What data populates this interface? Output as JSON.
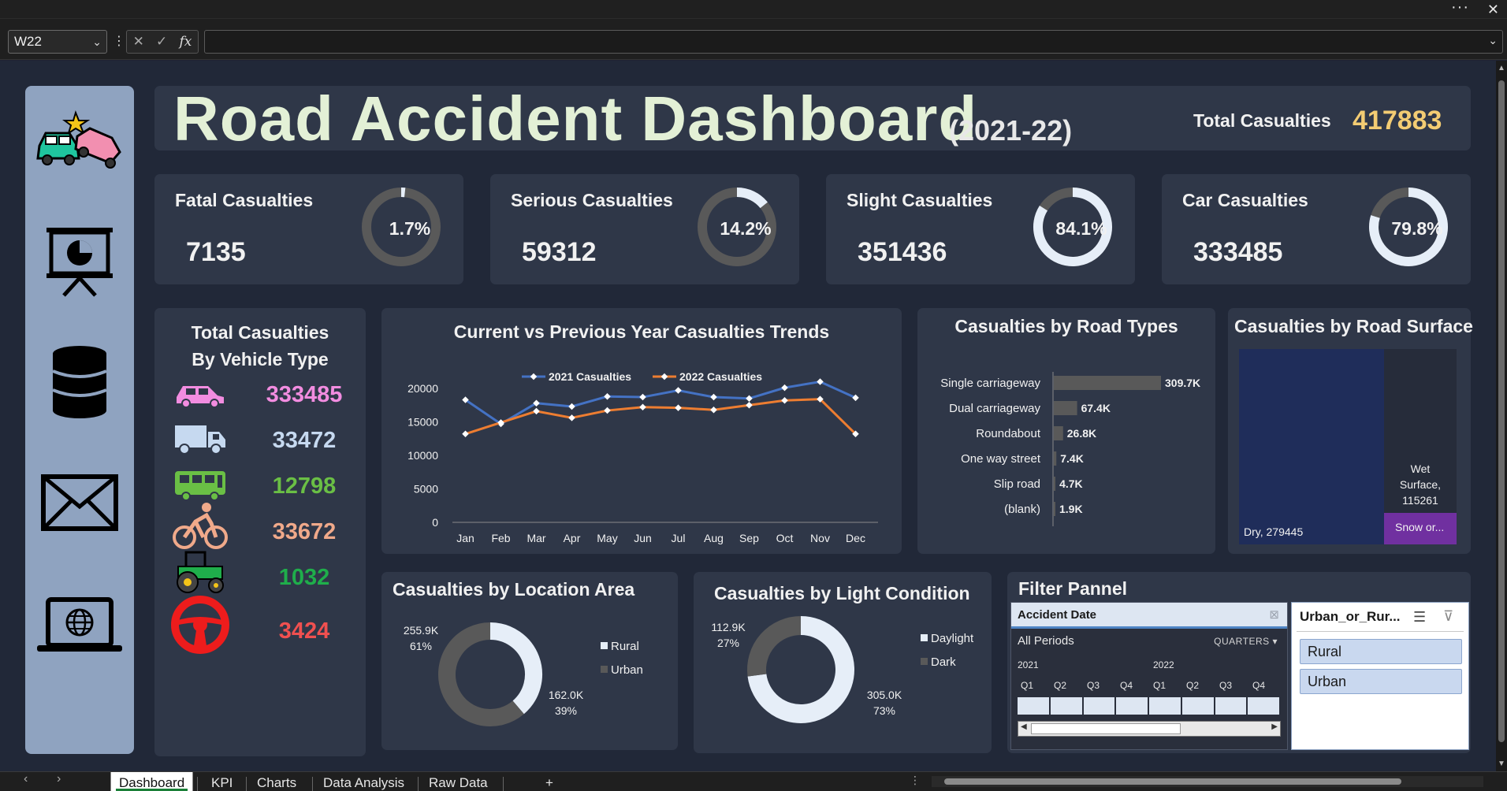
{
  "window": {
    "more_label": "···",
    "close_label": "✕"
  },
  "formula_bar": {
    "name_box": "W22",
    "fx_label": "fx",
    "formula": ""
  },
  "dashboard": {
    "title": "Road Accident Dashboard",
    "year": "(2021-22)",
    "total_label": "Total Casualties",
    "total_value": "417883",
    "kpis": [
      {
        "label": "Fatal Casualties",
        "value": "7135",
        "pct_label": "1.7%",
        "pct": 0.017
      },
      {
        "label": "Serious Casualties",
        "value": "59312",
        "pct_label": "14.2%",
        "pct": 0.142
      },
      {
        "label": "Slight Casualties",
        "value": "351436",
        "pct_label": "84.1%",
        "pct": 0.841
      },
      {
        "label": "Car Casualties",
        "value": "333485",
        "pct_label": "79.8%",
        "pct": 0.798
      }
    ],
    "vehicle": {
      "title_line1": "Total Casualties",
      "title_line2": "By Vehicle Type",
      "rows": [
        {
          "icon": "car-icon",
          "value": "333485",
          "color": "#f28ce0"
        },
        {
          "icon": "truck-icon",
          "value": "33472",
          "color": "#c6d9f0"
        },
        {
          "icon": "bus-icon",
          "value": "12798",
          "color": "#6abf45"
        },
        {
          "icon": "bicycle-icon",
          "value": "33672",
          "color": "#f0a98a"
        },
        {
          "icon": "tractor-icon",
          "value": "1032",
          "color": "#1fae4b"
        },
        {
          "icon": "steering-wheel-icon",
          "value": "3424",
          "color": "#f05050"
        }
      ]
    },
    "colors": {
      "accent_title": "#e3f0d6",
      "total_value": "#f3cc73",
      "series_2021": "#4472c4",
      "series_2022": "#ed7d31",
      "bar": "#595959"
    }
  },
  "chart_data": [
    {
      "type": "line",
      "title": "Current vs Previous Year Casualties Trends",
      "categories": [
        "Jan",
        "Feb",
        "Mar",
        "Apr",
        "May",
        "Jun",
        "Jul",
        "Aug",
        "Sep",
        "Oct",
        "Nov",
        "Dec"
      ],
      "series": [
        {
          "name": "2021 Casualties",
          "values": [
            18300,
            14700,
            17800,
            17300,
            18800,
            18700,
            19700,
            18700,
            18500,
            20100,
            21000,
            18600
          ]
        },
        {
          "name": "2022 Casualties",
          "values": [
            13200,
            14900,
            16600,
            15600,
            16700,
            17200,
            17100,
            16800,
            17500,
            18200,
            18400,
            13200
          ]
        }
      ],
      "yticks": [
        "0",
        "5000",
        "10000",
        "15000",
        "20000"
      ],
      "ylim": [
        0,
        22000
      ],
      "legend": "top"
    },
    {
      "type": "bar",
      "title": "Casualties by Road Types",
      "categories": [
        "Single carriageway",
        "Dual carriageway",
        "Roundabout",
        "One way street",
        "Slip road",
        "(blank)"
      ],
      "values": [
        309.7,
        67.4,
        26.8,
        7.4,
        4.7,
        1.9
      ],
      "labels": [
        "309.7K",
        "67.4K",
        "26.8K",
        "7.4K",
        "4.7K",
        "1.9K"
      ],
      "orientation": "horizontal"
    },
    {
      "type": "treemap",
      "title": "Casualties by Road Surface",
      "items": [
        {
          "name": "Dry",
          "label": "Dry, 279445",
          "value": 279445,
          "color": "#1f2d5a"
        },
        {
          "name": "Wet Surface",
          "label_lines": [
            "Wet",
            "Surface,",
            "115261"
          ],
          "value": 115261,
          "color": "#262c3a"
        },
        {
          "name": "Snow",
          "label": "Snow or...",
          "color": "#7030a0"
        }
      ]
    },
    {
      "type": "pie",
      "title": "Casualties by Location Area",
      "slices": [
        {
          "name": "Rural",
          "value_label": "162.0K",
          "pct_label": "39%",
          "value": 162.0
        },
        {
          "name": "Urban",
          "value_label": "255.9K",
          "pct_label": "61%",
          "value": 255.9
        }
      ],
      "legend": "right"
    },
    {
      "type": "pie",
      "title": "Casualties by Light Condition",
      "slices": [
        {
          "name": "Daylight",
          "value_label": "305.0K",
          "pct_label": "73%",
          "value": 305.0
        },
        {
          "name": "Dark",
          "value_label": "112.9K",
          "pct_label": "27%",
          "value": 112.9
        }
      ],
      "legend": "right"
    }
  ],
  "filter": {
    "title": "Filter Pannel",
    "timeline": {
      "title": "Accident Date",
      "period": "All Periods",
      "level": "QUARTERS",
      "years": [
        "2021",
        "2022"
      ],
      "quarters": [
        "Q1",
        "Q2",
        "Q3",
        "Q4",
        "Q1",
        "Q2",
        "Q3",
        "Q4"
      ]
    },
    "slicer": {
      "title": "Urban_or_Rur...",
      "items": [
        "Rural",
        "Urban"
      ]
    }
  },
  "tabs": [
    "Dashboard",
    "KPI",
    "Charts",
    "Data Analysis",
    "Raw Data"
  ],
  "add_sheet": "+"
}
